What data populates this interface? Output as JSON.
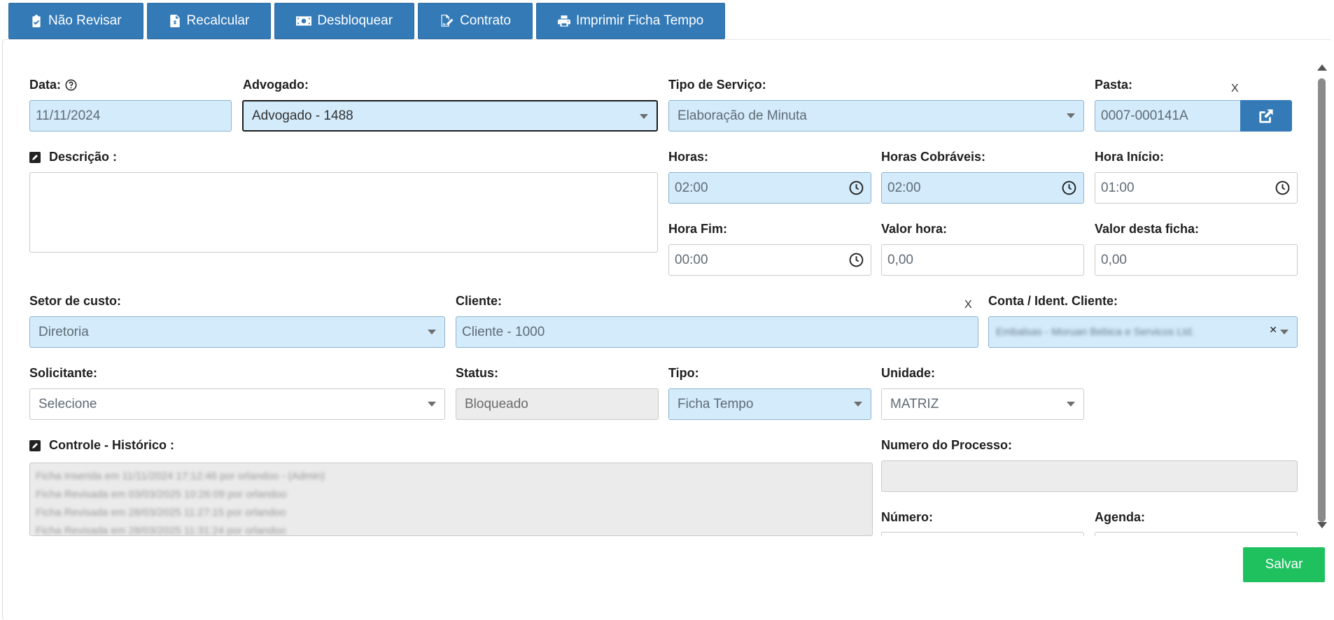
{
  "toolbar": {
    "buttons": [
      {
        "label": "Não Revisar",
        "icon": "clipboard-check-icon"
      },
      {
        "label": "Recalcular",
        "icon": "file-invoice-icon"
      },
      {
        "label": "Desbloquear",
        "icon": "money-bill-icon"
      },
      {
        "label": "Contrato",
        "icon": "file-signature-icon"
      },
      {
        "label": "Imprimir Ficha Tempo",
        "icon": "print-icon"
      }
    ]
  },
  "form": {
    "data": {
      "label": "Data:",
      "value": "11/11/2024"
    },
    "advogado": {
      "label": "Advogado:",
      "value": "Advogado - 1488"
    },
    "tipo_servico": {
      "label": "Tipo de Serviço:",
      "value": "Elaboração de Minuta"
    },
    "pasta": {
      "label": "Pasta:",
      "value": "0007-000141A",
      "clear": "X"
    },
    "descricao": {
      "label": "Descrição :",
      "value": ""
    },
    "horas": {
      "label": "Horas:",
      "value": "02:00"
    },
    "horas_cobraveis": {
      "label": "Horas Cobráveis:",
      "value": "02:00"
    },
    "hora_inicio": {
      "label": "Hora Início:",
      "value": "01:00"
    },
    "hora_fim": {
      "label": "Hora Fim:",
      "value": "00:00"
    },
    "valor_hora": {
      "label": "Valor hora:",
      "value": "0,00"
    },
    "valor_ficha": {
      "label": "Valor desta ficha:",
      "value": "0,00"
    },
    "setor_custo": {
      "label": "Setor de custo:",
      "value": "Diretoria"
    },
    "cliente": {
      "label": "Cliente:",
      "value": "Cliente - 1000",
      "clear": "X"
    },
    "conta_cliente": {
      "label": "Conta / Ident. Cliente:",
      "value": "Embalsas - Moruan Bebica e Servicos Ltd."
    },
    "solicitante": {
      "label": "Solicitante:",
      "value": "Selecione"
    },
    "status": {
      "label": "Status:",
      "value": "Bloqueado"
    },
    "tipo": {
      "label": "Tipo:",
      "value": "Ficha Tempo"
    },
    "unidade": {
      "label": "Unidade:",
      "value": "MATRIZ"
    },
    "controle": {
      "label": "Controle - Histórico :",
      "lines": [
        "Ficha Inserida em 11/11/2024 17:12:46 por orlandoo - (Admin)",
        "Ficha Revisada em 03/03/2025 10:26:09 por orlandoo",
        "Ficha Revisada em 28/03/2025 11:27:15 por orlandoo",
        "Ficha Revisada em 28/03/2025 11:31:24 por orlandoo"
      ]
    },
    "numero_processo": {
      "label": "Numero do Processo:",
      "value": ""
    },
    "numero": {
      "label": "Número:"
    },
    "agenda": {
      "label": "Agenda:"
    }
  },
  "actions": {
    "save_label": "Salvar"
  },
  "colors": {
    "primary": "#337ab7",
    "success": "#1fc15f",
    "field_blue": "#d3ebfb"
  }
}
